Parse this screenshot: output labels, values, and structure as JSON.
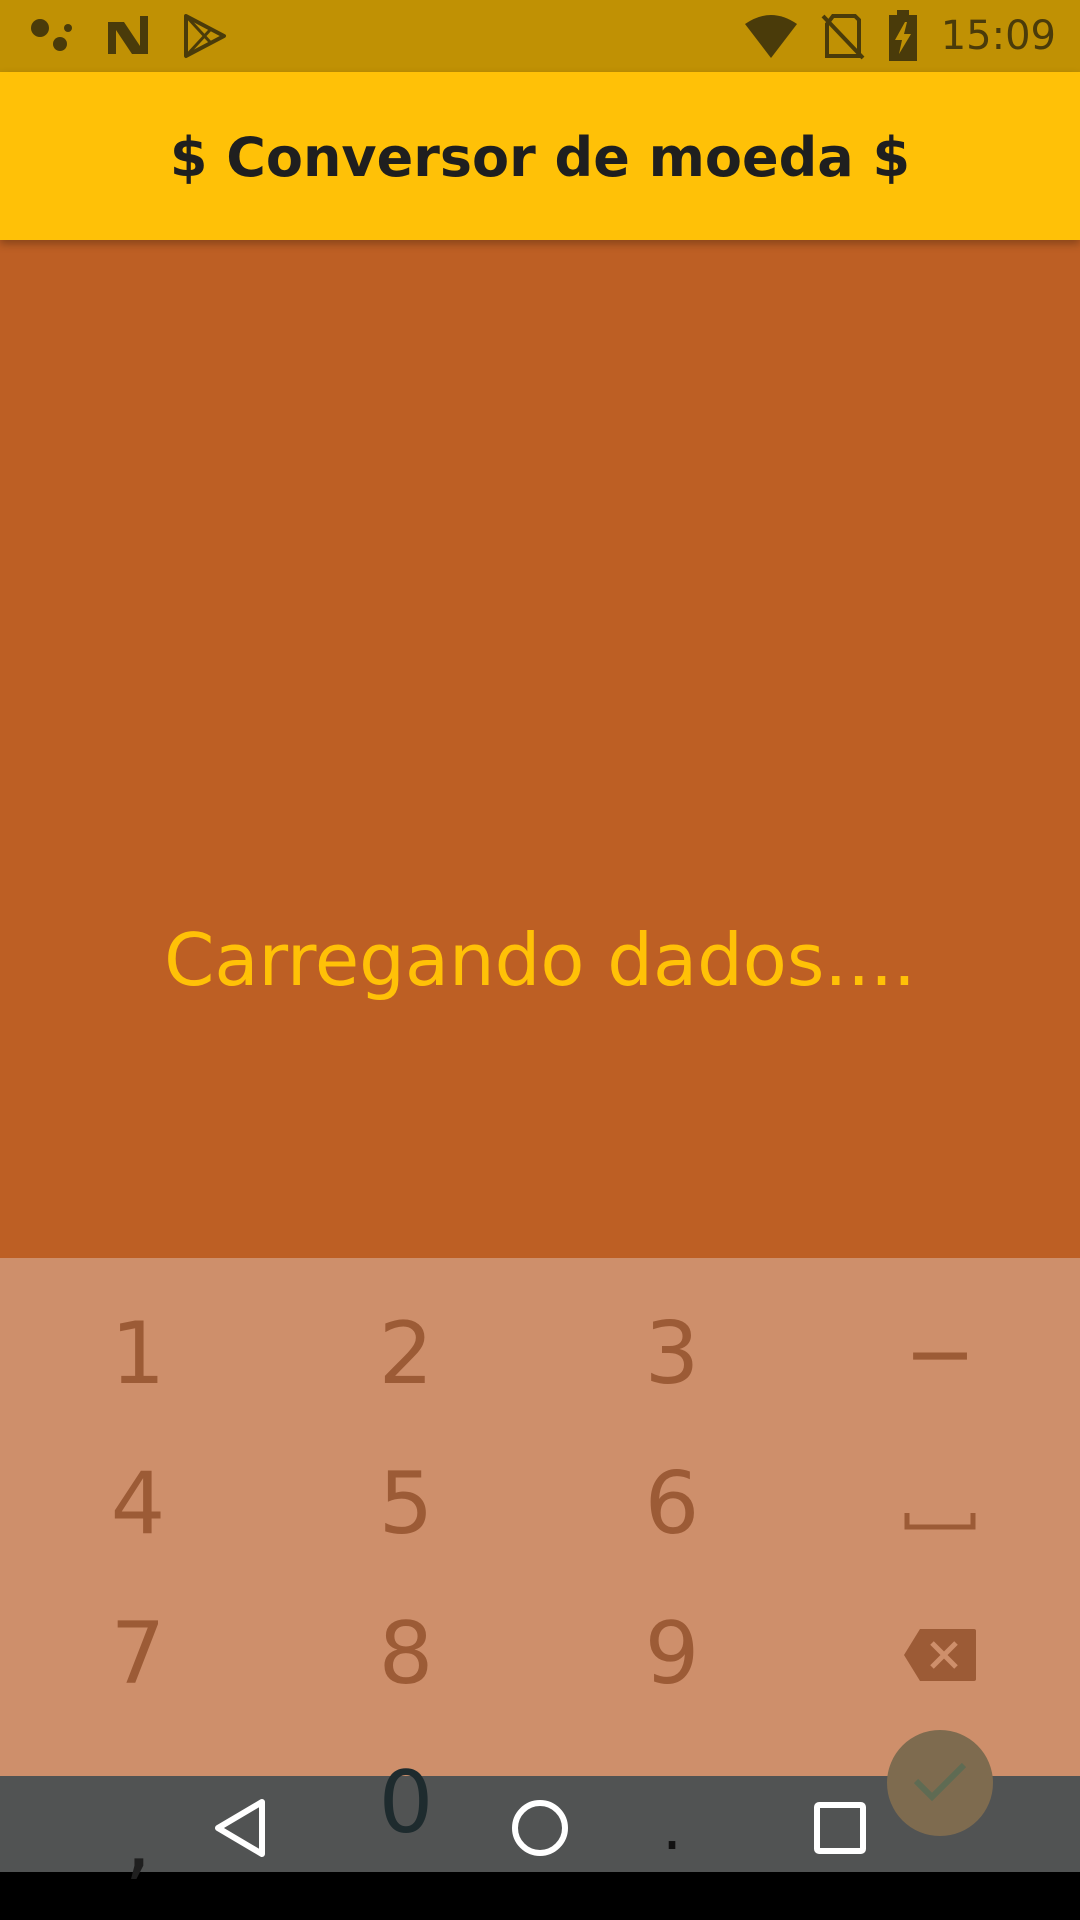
{
  "status_bar": {
    "time": "15:09",
    "icons_left": [
      "assistant-icon",
      "n-logo-icon",
      "play-store-icon"
    ],
    "icons_right": [
      "wifi-icon",
      "no-sim-icon",
      "battery-charging-icon"
    ]
  },
  "app_bar": {
    "title": "$ Conversor de moeda $"
  },
  "content": {
    "loading_text": "Carregando dados...."
  },
  "keyboard": {
    "rows": [
      [
        "1",
        "2",
        "3",
        "−"
      ],
      [
        "4",
        "5",
        "6",
        "space"
      ],
      [
        "7",
        "8",
        "9",
        "backspace"
      ],
      [
        ",",
        "0",
        ".",
        "confirm"
      ]
    ],
    "keys": {
      "k1": "1",
      "k2": "2",
      "k3": "3",
      "minus": "−",
      "k4": "4",
      "k5": "5",
      "k6": "6",
      "k7": "7",
      "k8": "8",
      "k9": "9",
      "comma": ",",
      "k0": "0",
      "period": "."
    }
  },
  "nav_bar": {
    "buttons": [
      "back-icon",
      "home-icon",
      "recents-icon"
    ]
  },
  "colors": {
    "status_bar": "#c09104",
    "app_bar": "#ffc107",
    "content_bg": "#bd5f24",
    "loading_text": "#ffc107",
    "keyboard_bg": "#ce8f6b",
    "key_text": "#9c5b36",
    "confirm_button": "#7e6b4f",
    "nav_bar": "#515353"
  }
}
